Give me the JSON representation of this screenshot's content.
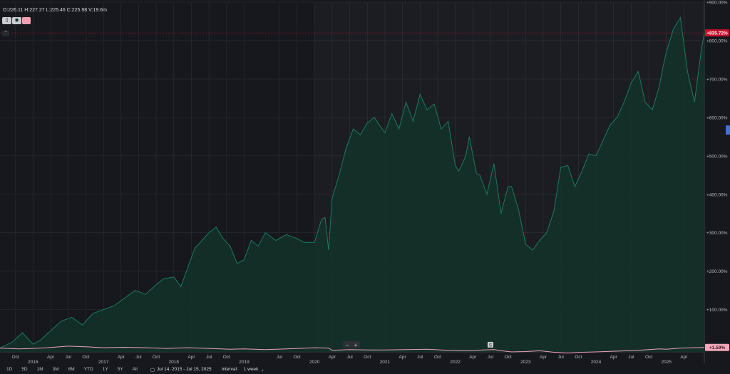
{
  "legend": {
    "ohlc": "O:226.11  H:227.27  L:225.46  C:225.98  V:19.6m"
  },
  "toolbar": {
    "ranges": [
      "1D",
      "5D",
      "1M",
      "3M",
      "6M",
      "YTD",
      "1Y",
      "5Y",
      "All"
    ],
    "date_range": "Jul 14, 2015 - Jul 15, 2025",
    "interval_label": "Interval:",
    "interval_value": "1 week"
  },
  "colors": {
    "background": "#16181d",
    "main_line": "#1c7a5e",
    "main_fill": "#123329",
    "compare_line": "#f0a0b8",
    "badge_main": "#c8102e",
    "badge_compare": "#f3a7b8",
    "grid": "#2a2e36"
  },
  "event_marker": "S",
  "chart_data": {
    "type": "area",
    "ylim": [
      -10,
      900
    ],
    "y_ticks": [
      100,
      200,
      300,
      400,
      500,
      600,
      700,
      800,
      900
    ],
    "y_tick_labels": [
      "+100.00%",
      "+200.00%",
      "+300.00%",
      "+400.00%",
      "+500.00%",
      "+600.00%",
      "+700.00%",
      "+800.00%",
      "+900.00%"
    ],
    "x_range": [
      2015.53,
      2025.54
    ],
    "x_ticks": [
      {
        "x": 2015.75,
        "label": "Oct"
      },
      {
        "x": 2016.0,
        "label": "2016",
        "year": true
      },
      {
        "x": 2016.25,
        "label": "Apr"
      },
      {
        "x": 2016.5,
        "label": "Jul"
      },
      {
        "x": 2016.75,
        "label": "Oct"
      },
      {
        "x": 2017.0,
        "label": "2017",
        "year": true
      },
      {
        "x": 2017.25,
        "label": "Apr"
      },
      {
        "x": 2017.5,
        "label": "Jul"
      },
      {
        "x": 2017.75,
        "label": "Oct"
      },
      {
        "x": 2018.0,
        "label": "2018",
        "year": true
      },
      {
        "x": 2018.25,
        "label": "Apr"
      },
      {
        "x": 2018.5,
        "label": "Jul"
      },
      {
        "x": 2018.75,
        "label": "Oct"
      },
      {
        "x": 2019.0,
        "label": "2019",
        "year": true
      },
      {
        "x": 2019.5,
        "label": "Jul"
      },
      {
        "x": 2019.75,
        "label": "Oct"
      },
      {
        "x": 2020.0,
        "label": "2020",
        "year": true
      },
      {
        "x": 2020.25,
        "label": "Apr"
      },
      {
        "x": 2020.5,
        "label": "Jul"
      },
      {
        "x": 2020.75,
        "label": "Oct"
      },
      {
        "x": 2021.0,
        "label": "2021",
        "year": true
      },
      {
        "x": 2021.25,
        "label": "Apr"
      },
      {
        "x": 2021.5,
        "label": "Jul"
      },
      {
        "x": 2021.75,
        "label": "Oct"
      },
      {
        "x": 2022.0,
        "label": "2022",
        "year": true
      },
      {
        "x": 2022.25,
        "label": "Apr"
      },
      {
        "x": 2022.5,
        "label": "Jul"
      },
      {
        "x": 2022.75,
        "label": "Oct"
      },
      {
        "x": 2023.0,
        "label": "2023",
        "year": true
      },
      {
        "x": 2023.25,
        "label": "Apr"
      },
      {
        "x": 2023.5,
        "label": "Jul"
      },
      {
        "x": 2023.75,
        "label": "Oct"
      },
      {
        "x": 2024.0,
        "label": "2024",
        "year": true
      },
      {
        "x": 2024.25,
        "label": "Apr"
      },
      {
        "x": 2024.5,
        "label": "Jul"
      },
      {
        "x": 2024.75,
        "label": "Oct"
      },
      {
        "x": 2025.0,
        "label": "2025",
        "year": true
      },
      {
        "x": 2025.25,
        "label": "Apr"
      }
    ],
    "last_value_main": "+835.72%",
    "last_value_compare": "+1.59%",
    "grid": true,
    "series": [
      {
        "x": [
          2015.53,
          2015.7,
          2015.85,
          2016.0,
          2016.1,
          2016.25,
          2016.4,
          2016.55,
          2016.7,
          2016.85,
          2017.0,
          2017.15,
          2017.3,
          2017.45,
          2017.6,
          2017.75,
          2017.85,
          2018.0,
          2018.1,
          2018.2,
          2018.3,
          2018.4,
          2018.5,
          2018.6,
          2018.7,
          2018.8,
          2018.9,
          2019.0,
          2019.1,
          2019.2,
          2019.3,
          2019.45,
          2019.6,
          2019.75,
          2019.85,
          2020.0,
          2020.1,
          2020.15,
          2020.2,
          2020.25,
          2020.35,
          2020.45,
          2020.55,
          2020.65,
          2020.75,
          2020.85,
          2021.0,
          2021.1,
          2021.2,
          2021.3,
          2021.4,
          2021.5,
          2021.6,
          2021.7,
          2021.8,
          2021.9,
          2022.0,
          2022.05,
          2022.15,
          2022.2,
          2022.3,
          2022.35,
          2022.45,
          2022.55,
          2022.65,
          2022.75,
          2022.8,
          2022.9,
          2023.0,
          2023.1,
          2023.2,
          2023.3,
          2023.4,
          2023.5,
          2023.6,
          2023.7,
          2023.8,
          2023.9,
          2024.0,
          2024.1,
          2024.2,
          2024.3,
          2024.4,
          2024.5,
          2024.6,
          2024.7,
          2024.8,
          2024.9,
          2024.95,
          2025.0,
          2025.1,
          2025.2,
          2025.3,
          2025.4,
          2025.5,
          2025.54
        ],
        "values": [
          0,
          15,
          40,
          10,
          20,
          45,
          70,
          80,
          60,
          90,
          100,
          110,
          130,
          150,
          140,
          165,
          180,
          185,
          160,
          210,
          260,
          280,
          300,
          315,
          285,
          265,
          220,
          230,
          280,
          265,
          300,
          280,
          295,
          285,
          275,
          275,
          335,
          340,
          255,
          390,
          450,
          520,
          570,
          555,
          585,
          600,
          560,
          610,
          570,
          640,
          590,
          660,
          620,
          635,
          570,
          590,
          475,
          460,
          500,
          550,
          455,
          450,
          400,
          480,
          350,
          420,
          420,
          360,
          270,
          255,
          280,
          300,
          355,
          470,
          475,
          420,
          460,
          505,
          500,
          540,
          580,
          600,
          640,
          690,
          720,
          640,
          620,
          680,
          730,
          770,
          830,
          860,
          720,
          640,
          780,
          820
        ]
      },
      {
        "x": [
          2015.53,
          2015.8,
          2016.0,
          2016.2,
          2016.5,
          2016.8,
          2017.0,
          2017.3,
          2017.6,
          2017.9,
          2018.2,
          2018.5,
          2018.8,
          2019.0,
          2019.3,
          2019.6,
          2019.9,
          2020.0,
          2020.2,
          2020.25,
          2020.5,
          2020.8,
          2021.0,
          2021.3,
          2021.6,
          2021.9,
          2022.2,
          2022.4,
          2022.55,
          2022.7,
          2022.8,
          2023.0,
          2023.2,
          2023.4,
          2023.6,
          2023.8,
          2024.0,
          2024.3,
          2024.6,
          2024.9,
          2025.0,
          2025.2,
          2025.54
        ],
        "values": [
          0,
          -2,
          -1,
          1,
          5,
          3,
          1,
          2,
          1,
          -1,
          1,
          -1,
          -3,
          -2,
          -4,
          -2,
          0,
          1,
          0,
          -6,
          -4,
          -5,
          -5,
          -4,
          -3,
          -6,
          -7,
          -5,
          -4,
          -8,
          -10,
          -9,
          -7,
          -11,
          -13,
          -11,
          -10,
          -8,
          -6,
          -2,
          -3,
          0,
          1.59
        ]
      }
    ]
  }
}
